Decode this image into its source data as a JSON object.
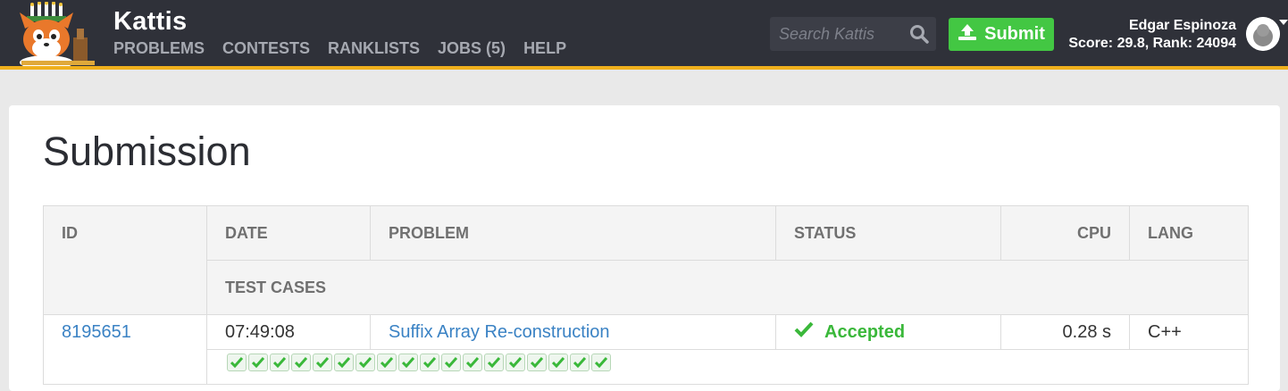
{
  "header": {
    "brand": "Kattis",
    "nav": [
      "PROBLEMS",
      "CONTESTS",
      "RANKLISTS",
      "JOBS (5)",
      "HELP"
    ],
    "search_placeholder": "Search Kattis",
    "submit_label": "Submit",
    "user_name": "Edgar Espinoza",
    "user_score": "Score: 29.8, Rank: 24094",
    "accent_color": "#f0b01c",
    "submit_color": "#43c743"
  },
  "page": {
    "title": "Submission"
  },
  "table": {
    "columns": [
      "ID",
      "DATE",
      "PROBLEM",
      "STATUS",
      "CPU",
      "LANG"
    ],
    "sub_header": "TEST CASES",
    "row": {
      "id": "8195651",
      "date": "07:49:08",
      "problem": "Suffix Array Re-construction",
      "status": "Accepted",
      "cpu": "0.28 s",
      "lang": "C++"
    },
    "test_cases": [
      "pass",
      "pass",
      "pass",
      "pass",
      "pass",
      "pass",
      "pass",
      "pass",
      "pass",
      "pass",
      "pass",
      "pass",
      "pass",
      "pass",
      "pass",
      "pass",
      "pass",
      "pass"
    ],
    "status_color": "#3ab83a"
  }
}
